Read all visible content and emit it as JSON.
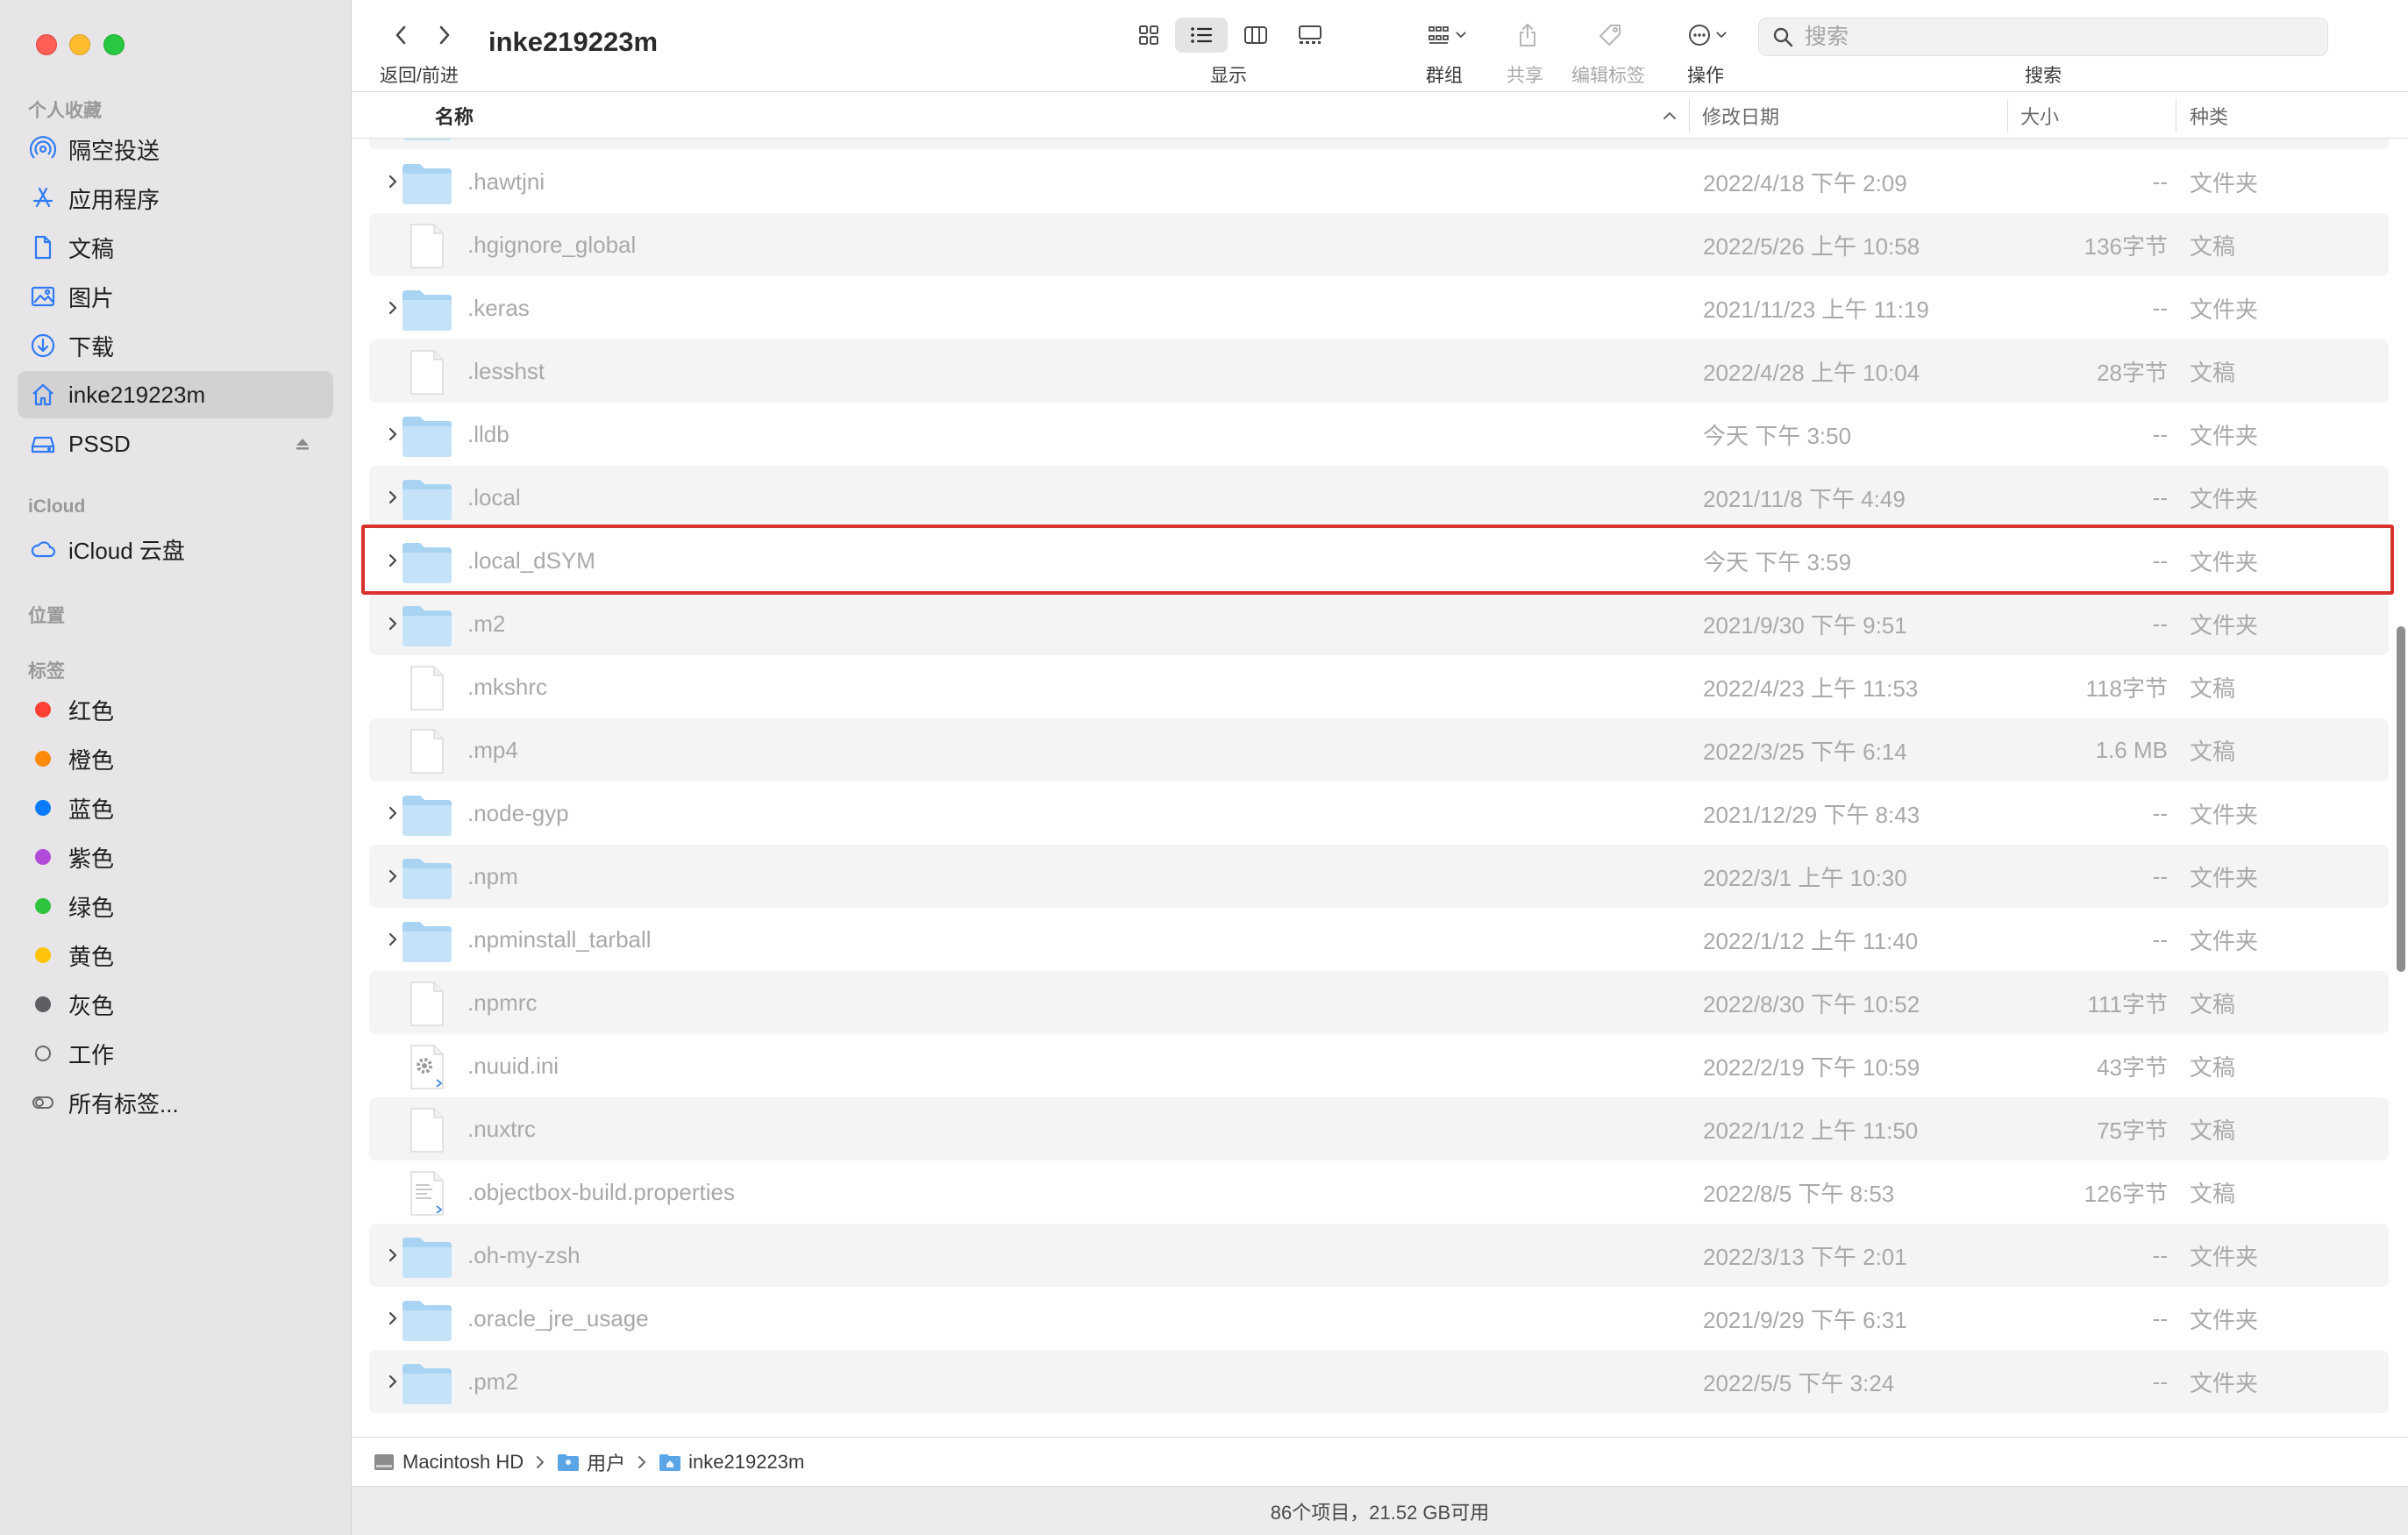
{
  "window": {
    "title": "inke219223m",
    "nav_caption": "返回/前进",
    "view_caption": "显示",
    "group_caption": "群组",
    "share_caption": "共享",
    "tags_caption": "编辑标签",
    "action_caption": "操作",
    "search_caption": "搜索",
    "search_placeholder": "搜索"
  },
  "sidebar": {
    "favorites_header": "个人收藏",
    "favorites": [
      {
        "label": "隔空投送",
        "icon": "airdrop-icon"
      },
      {
        "label": "应用程序",
        "icon": "applications-icon"
      },
      {
        "label": "文稿",
        "icon": "document-icon"
      },
      {
        "label": "图片",
        "icon": "pictures-icon"
      },
      {
        "label": "下载",
        "icon": "downloads-icon"
      },
      {
        "label": "inke219223m",
        "icon": "home-icon"
      },
      {
        "label": "PSSD",
        "icon": "drive-icon"
      }
    ],
    "icloud_header": "iCloud",
    "icloud_drive": "iCloud 云盘",
    "locations_header": "位置",
    "tags_header": "标签",
    "tags": [
      {
        "label": "红色",
        "color": "#fe4037"
      },
      {
        "label": "橙色",
        "color": "#fe8a0a"
      },
      {
        "label": "蓝色",
        "color": "#0b7bff"
      },
      {
        "label": "紫色",
        "color": "#b34bda"
      },
      {
        "label": "绿色",
        "color": "#2ec43d"
      },
      {
        "label": "黄色",
        "color": "#ffc40a"
      },
      {
        "label": "灰色",
        "color": "#8e8e93"
      },
      {
        "label": "工作",
        "color": ""
      },
      {
        "label": "所有标签...",
        "color": ""
      }
    ]
  },
  "columns": {
    "name": "名称",
    "date": "修改日期",
    "size": "大小",
    "kind": "种类"
  },
  "files": [
    {
      "name": ".hawtjni",
      "date": "2022/4/18 下午 2:09",
      "size": "--",
      "kind": "文件夹",
      "type": "folder"
    },
    {
      "name": ".hgignore_global",
      "date": "2022/5/26 上午 10:58",
      "size": "136字节",
      "kind": "文稿",
      "type": "doc"
    },
    {
      "name": ".keras",
      "date": "2021/11/23 上午 11:19",
      "size": "--",
      "kind": "文件夹",
      "type": "folder"
    },
    {
      "name": ".lesshst",
      "date": "2022/4/28 上午 10:04",
      "size": "28字节",
      "kind": "文稿",
      "type": "doc"
    },
    {
      "name": ".lldb",
      "date": "今天 下午 3:50",
      "size": "--",
      "kind": "文件夹",
      "type": "folder"
    },
    {
      "name": ".local",
      "date": "2021/11/8 下午 4:49",
      "size": "--",
      "kind": "文件夹",
      "type": "folder"
    },
    {
      "name": ".local_dSYM",
      "date": "今天 下午 3:59",
      "size": "--",
      "kind": "文件夹",
      "type": "folder"
    },
    {
      "name": ".m2",
      "date": "2021/9/30 下午 9:51",
      "size": "--",
      "kind": "文件夹",
      "type": "folder"
    },
    {
      "name": ".mkshrc",
      "date": "2022/4/23 上午 11:53",
      "size": "118字节",
      "kind": "文稿",
      "type": "doc"
    },
    {
      "name": ".mp4",
      "date": "2022/3/25 下午 6:14",
      "size": "1.6 MB",
      "kind": "文稿",
      "type": "doc"
    },
    {
      "name": ".node-gyp",
      "date": "2021/12/29 下午 8:43",
      "size": "--",
      "kind": "文件夹",
      "type": "folder"
    },
    {
      "name": ".npm",
      "date": "2022/3/1 上午 10:30",
      "size": "--",
      "kind": "文件夹",
      "type": "folder"
    },
    {
      "name": ".npminstall_tarball",
      "date": "2022/1/12 上午 11:40",
      "size": "--",
      "kind": "文件夹",
      "type": "folder"
    },
    {
      "name": ".npmrc",
      "date": "2022/8/30 下午 10:52",
      "size": "111字节",
      "kind": "文稿",
      "type": "doc"
    },
    {
      "name": ".nuuid.ini",
      "date": "2022/2/19 下午 10:59",
      "size": "43字节",
      "kind": "文稿",
      "type": "settings"
    },
    {
      "name": ".nuxtrc",
      "date": "2022/1/12 上午 11:50",
      "size": "75字节",
      "kind": "文稿",
      "type": "doc"
    },
    {
      "name": ".objectbox-build.properties",
      "date": "2022/8/5 下午 8:53",
      "size": "126字节",
      "kind": "文稿",
      "type": "textdoc"
    },
    {
      "name": ".oh-my-zsh",
      "date": "2022/3/13 下午 2:01",
      "size": "--",
      "kind": "文件夹",
      "type": "folder"
    },
    {
      "name": ".oracle_jre_usage",
      "date": "2021/9/29 下午 6:31",
      "size": "--",
      "kind": "文件夹",
      "type": "folder"
    },
    {
      "name": ".pm2",
      "date": "2022/5/5 下午 3:24",
      "size": "--",
      "kind": "文件夹",
      "type": "folder"
    }
  ],
  "path_bar": {
    "crumbs": [
      "Macintosh HD",
      "用户",
      "inke219223m"
    ]
  },
  "status_bar": {
    "text": "86个项目，21.52 GB可用"
  }
}
